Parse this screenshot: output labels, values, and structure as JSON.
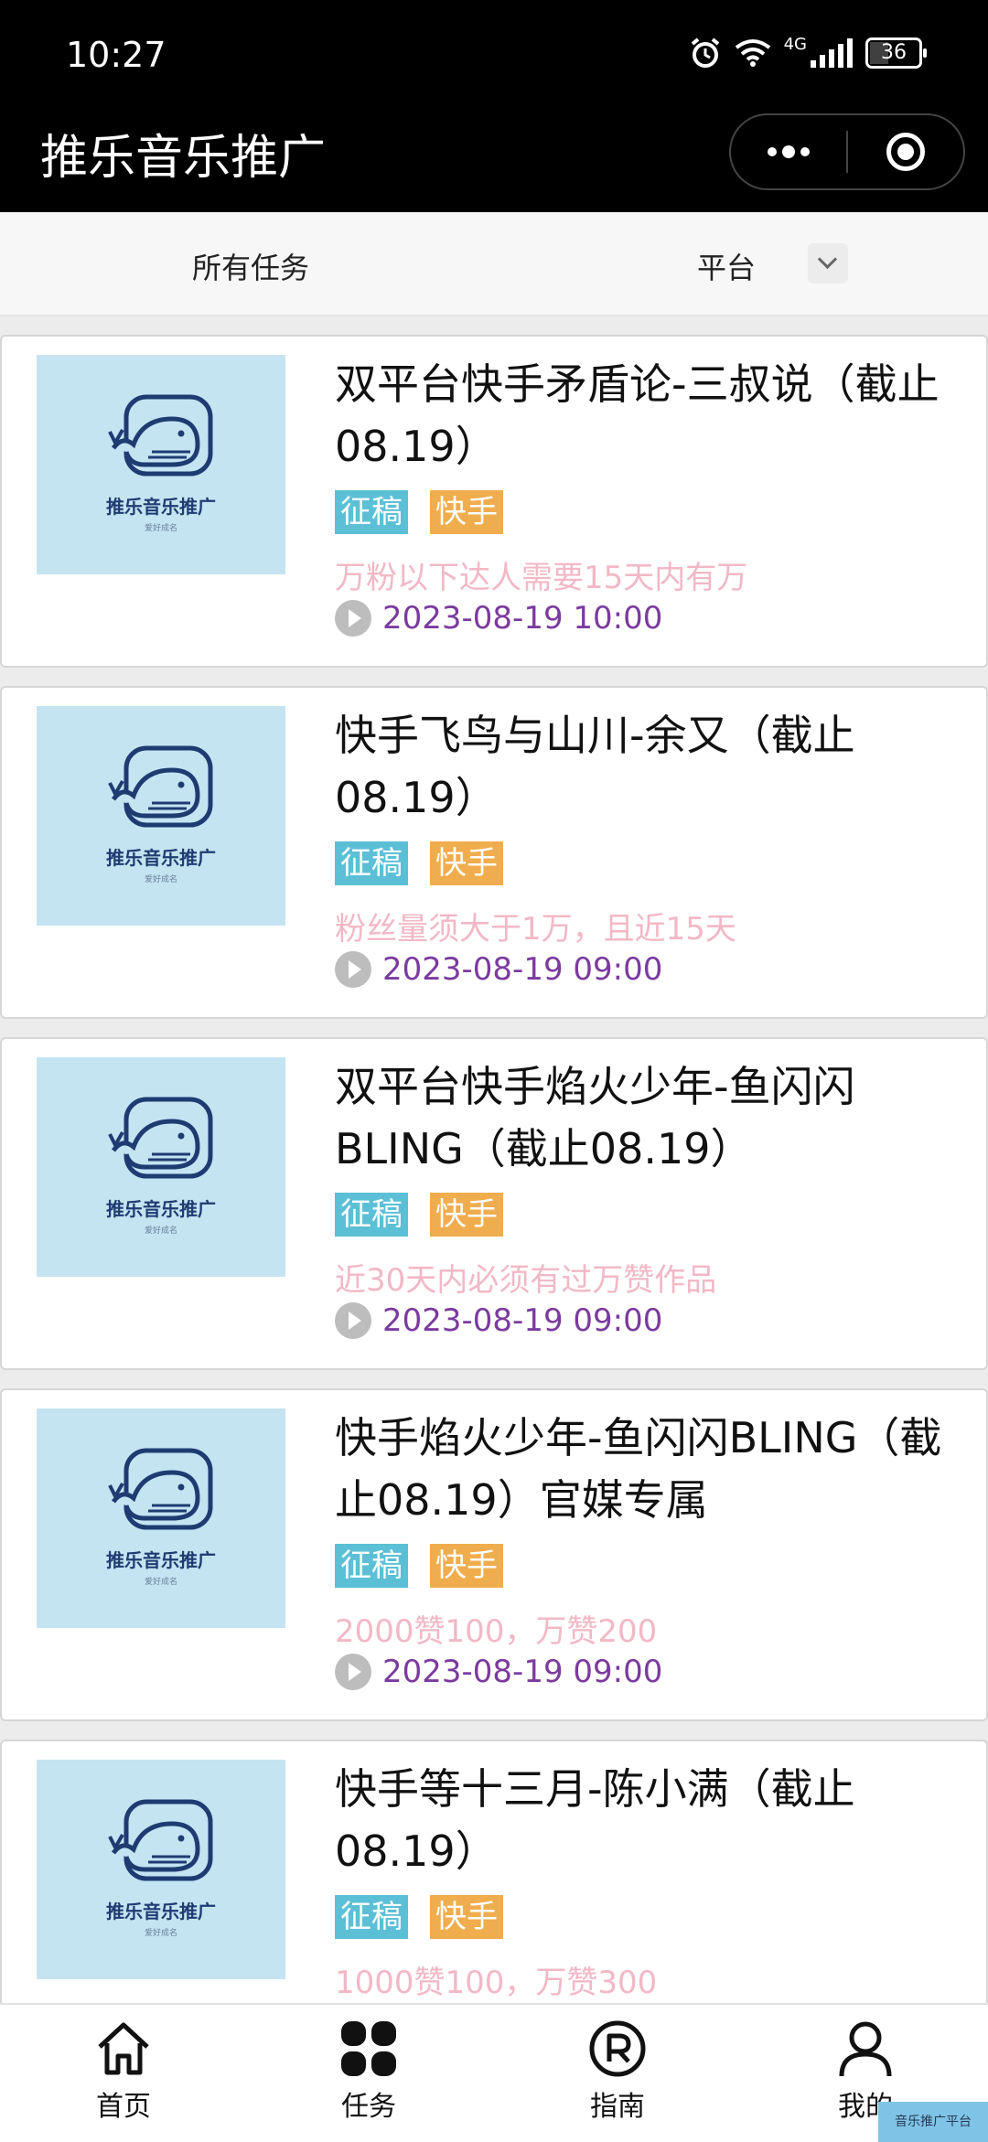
{
  "status_bar": {
    "time": "10:27",
    "network": "4G",
    "battery": "36"
  },
  "app_title": "推乐音乐推广",
  "filters": {
    "all_tasks": "所有任务",
    "platform": "平台"
  },
  "thumbnail": {
    "brand_text": "推乐音乐推广",
    "sub_text": "爱好成名"
  },
  "tasks": [
    {
      "title": "双平台快手矛盾论-三叔说（截止08.19）",
      "tags": [
        "征稿",
        "快手"
      ],
      "desc": "万粉以下达人需要15天内有万",
      "date": "2023-08-19 10:00"
    },
    {
      "title": "快手飞鸟与山川-余又（截止08.19）",
      "tags": [
        "征稿",
        "快手"
      ],
      "desc": "粉丝量须大于1万，且近15天",
      "date": "2023-08-19 09:00"
    },
    {
      "title": "双平台快手焰火少年-鱼闪闪BLING（截止08.19）",
      "tags": [
        "征稿",
        "快手"
      ],
      "desc": "近30天内必须有过万赞作品",
      "date": "2023-08-19 09:00"
    },
    {
      "title": "快手焰火少年-鱼闪闪BLING（截止08.19）官媒专属",
      "tags": [
        "征稿",
        "快手"
      ],
      "desc": "2000赞100，万赞200",
      "date": "2023-08-19 09:00"
    },
    {
      "title": "快手等十三月-陈小满（截止08.19）",
      "tags": [
        "征稿",
        "快手"
      ],
      "desc": "1000赞100，万赞300",
      "date": ""
    }
  ],
  "tabbar": [
    {
      "label": "首页",
      "icon": "home-icon"
    },
    {
      "label": "任务",
      "icon": "grid-icon"
    },
    {
      "label": "指南",
      "icon": "registered-icon"
    },
    {
      "label": "我的",
      "icon": "user-icon"
    }
  ],
  "watermark": "音乐推广平台"
}
